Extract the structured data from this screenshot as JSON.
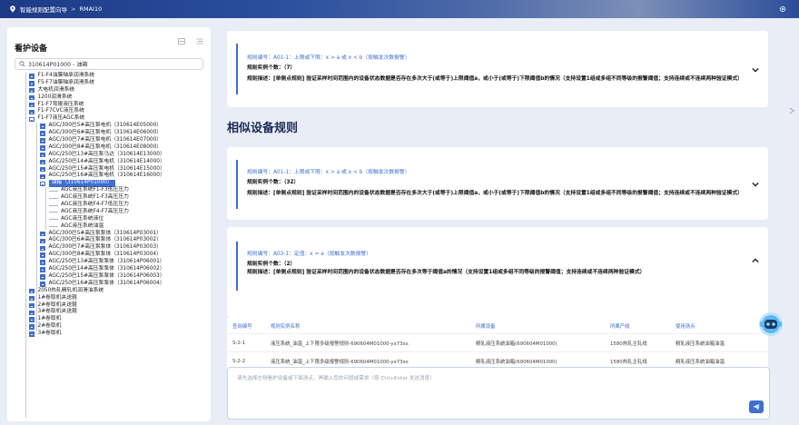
{
  "topbar": {
    "title": "智能规则配置向导",
    "crumb": "RMAI10"
  },
  "sidebar": {
    "title": "看护设备",
    "search_value": "310614P01000 - 油箱",
    "tree": [
      {
        "level": 1,
        "type": "collapsed",
        "label": "F1-F4油膜轴承润滑系统"
      },
      {
        "level": 1,
        "type": "collapsed",
        "label": "F5-F7油膜轴承润滑系统"
      },
      {
        "level": 1,
        "type": "collapsed",
        "label": "大电机润滑系统"
      },
      {
        "level": 1,
        "type": "collapsed",
        "label": "1200润滑系统"
      },
      {
        "level": 1,
        "type": "collapsed",
        "label": "F1-F7弯辊液压系统"
      },
      {
        "level": 1,
        "type": "collapsed",
        "label": "F1-F7CVC液压系统"
      },
      {
        "level": 1,
        "type": "open",
        "label": "F1-F7液压AGC系统"
      },
      {
        "level": 2,
        "type": "collapsed",
        "label": "AGC/300巴5#高压泵电机（310614E05000）"
      },
      {
        "level": 2,
        "type": "collapsed",
        "label": "AGC/300巴6#高压泵电机（310614E06000）"
      },
      {
        "level": 2,
        "type": "collapsed",
        "label": "AGC/300巴7#高压泵电机（310614E07000）"
      },
      {
        "level": 2,
        "type": "collapsed",
        "label": "AGC/300巴8#高压泵电机（310614E08000）"
      },
      {
        "level": 2,
        "type": "collapsed",
        "label": "AGC/250巴13#高压泵马达（310614E13000）"
      },
      {
        "level": 2,
        "type": "collapsed",
        "label": "AGC/250巴14#高压泵电机（310614E14000）"
      },
      {
        "level": 2,
        "type": "collapsed",
        "label": "AGC/250巴15#高压泵电机（310614E15000）"
      },
      {
        "level": 2,
        "type": "collapsed",
        "label": "AGC/250巴16#高压泵电机（310614E16000）"
      },
      {
        "level": 2,
        "type": "selected",
        "label": "油箱（310614P01000）"
      },
      {
        "level": 3,
        "type": "leaf",
        "label": "AGC液压系统F1-F3低压压力"
      },
      {
        "level": 3,
        "type": "leaf",
        "label": "AGC液压系统F1-F3高压压力"
      },
      {
        "level": 3,
        "type": "leaf",
        "label": "AGC液压系统F4-F7低压压力"
      },
      {
        "level": 3,
        "type": "leaf",
        "label": "AGC液压系统F4-F7高压压力"
      },
      {
        "level": 3,
        "type": "leaf",
        "label": "AGC液压系统液位"
      },
      {
        "level": 3,
        "type": "leaf",
        "label": "AGC液压系统油温"
      },
      {
        "level": 2,
        "type": "collapsed",
        "label": "AGC/300巴5#高压泵泵体（310614P03001）"
      },
      {
        "level": 2,
        "type": "collapsed",
        "label": "AGC/300巴6#高压泵泵体（310614P03002）"
      },
      {
        "level": 2,
        "type": "collapsed",
        "label": "AGC/300巴7#高压泵泵体（310614P03003）"
      },
      {
        "level": 2,
        "type": "collapsed",
        "label": "AGC/300巴8#高压泵泵体（310614P03004）"
      },
      {
        "level": 2,
        "type": "collapsed",
        "label": "AGC/250巴13#高压泵泵体（310614P06001）"
      },
      {
        "level": 2,
        "type": "collapsed",
        "label": "AGC/250巴14#高压泵泵体（310614P06002）"
      },
      {
        "level": 2,
        "type": "collapsed",
        "label": "AGC/250巴15#高压泵泵体（310614P06003）"
      },
      {
        "level": 2,
        "type": "collapsed",
        "label": "AGC/250巴16#高压泵泵体（310614P06004）"
      },
      {
        "level": 1,
        "type": "collapsed",
        "label": "2050热轧精轧机润滑油系统"
      },
      {
        "level": 1,
        "type": "collapsed",
        "label": "1#卷取机夹送辊"
      },
      {
        "level": 1,
        "type": "collapsed",
        "label": "2#卷取机夹送辊"
      },
      {
        "level": 1,
        "type": "collapsed",
        "label": "3#卷取机夹送辊"
      },
      {
        "level": 1,
        "type": "collapsed",
        "label": "1#卷取机"
      },
      {
        "level": 1,
        "type": "collapsed",
        "label": "2#卷取机"
      },
      {
        "level": 1,
        "type": "collapsed",
        "label": "3#卷取机"
      }
    ]
  },
  "top_card": {
    "rule_id": "规则编号：A01-1：上限或下限：x > a 或 x < b（按触发次数报警）",
    "instances": "规则实例个数：（7）",
    "desc": "规则描述：[单侧点规则] 验证采样时间范围内的设备状态数据是否存在多次大于(或等于)上限阈值a，或小于(或等于)下限阈值b的情况（支持设置1组或多组不同等级的报警阈值；支持连续或不连续两种验证模式）"
  },
  "similar_title": "相似设备规则",
  "card2": {
    "rule_id": "规则编号：A01-1：上限或下限：x > a 或 x < b（按触发次数报警）",
    "instances": "规则实例个数：（32）",
    "desc": "规则描述：[单侧点规则] 验证采样时间范围内的设备状态数据是否存在多次大于(或等于)上限阈值a，或小于(或等于)下限阈值b的情况（支持设置1组或多组不同等级的报警阈值；支持连续或不连续两种验证模式）"
  },
  "card3": {
    "rule_id": "规则编号：A03-1：定值：x = a（按触发次数报警）",
    "instances": "规则实例个数：（2）",
    "desc": "规则描述：[单侧点规则] 验证采样时间范围内的设备状态数据是否存在多次等于阈值a的情况（支持设置1组或多组不同等级的报警阈值；支持连续或不连续两种验证模式）"
  },
  "table": {
    "headers": [
      "查询编号",
      "规则实例名称",
      "所属设备",
      "所属产线",
      "使用测点"
    ],
    "rows": [
      [
        "S-2-1",
        "液压系统_油温_上下限多级报警规则-690604M01000-yx73xs",
        "精轧液压系统油箱(690604M01000)",
        "1580热轧主轧线",
        "精轧液压系统油箱油温"
      ],
      [
        "S-2-2",
        "液压系统_油温_上下限多级报警规则-690604M01000-yx73xs",
        "精轧液压系统油箱(690604M01000)",
        "1580热轧主轧线",
        "精轧液压系统油箱油温"
      ]
    ]
  },
  "input": {
    "placeholder": "请先选择左侧看护设备或下面测点，再输入您的问题或需求（按 Ctrl+Enter 发送消息）"
  },
  "colors": {
    "accent": "#3e6fd1",
    "topbar": "#1c3a86"
  }
}
